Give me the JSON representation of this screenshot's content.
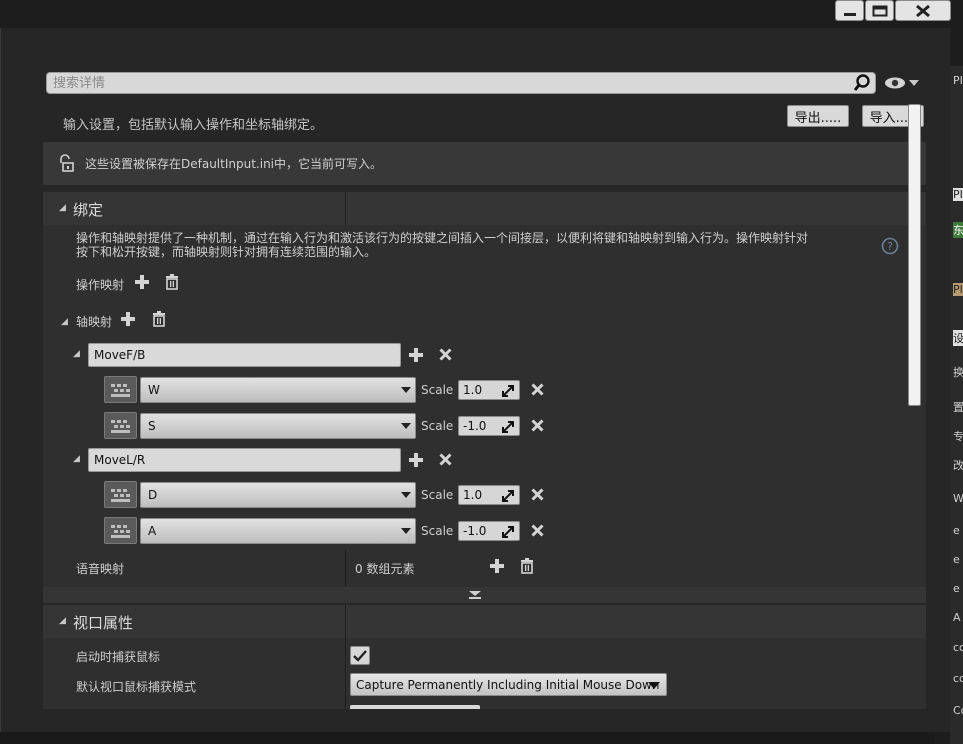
{
  "search": {
    "placeholder": "搜索详情"
  },
  "header": {
    "description": "输入设置，包括默认输入操作和坐标轴绑定。",
    "export_label": "导出.....",
    "import_label": "导入....."
  },
  "notice": {
    "text": "这些设置被保存在DefaultInput.ini中，它当前可写入。"
  },
  "bindings": {
    "title": "绑定",
    "help_line1": "操作和轴映射提供了一种机制，通过在输入行为和激活该行为的按键之间插入一个间接层，以便利将键和轴映射到输入行为。操作映射针对",
    "help_line2": "按下和松开按键，而轴映射则针对拥有连续范围的输入。",
    "action_mappings_label": "操作映射",
    "axis_mappings_label": "轴映射",
    "scale_label": "Scale",
    "axis_groups": [
      {
        "name": "MoveF/B",
        "keys": [
          {
            "key": "W",
            "scale": "1.0"
          },
          {
            "key": "S",
            "scale": "-1.0"
          }
        ]
      },
      {
        "name": "MoveL/R",
        "keys": [
          {
            "key": "D",
            "scale": "1.0"
          },
          {
            "key": "A",
            "scale": "-1.0"
          }
        ]
      }
    ],
    "speech_mappings_label": "语音映射",
    "speech_mappings_value": "0 数组元素"
  },
  "viewport": {
    "title": "视口属性",
    "capture_on_start_label": "启动时捕获鼠标",
    "capture_on_start_checked": true,
    "capture_mode_label": "默认视口鼠标捕获模式",
    "capture_mode_value": "Capture Permanently Including Initial Mouse Down"
  },
  "right_fragments": [
    "PI",
    "东",
    "Pla",
    "设",
    "换",
    "置",
    "专",
    "改",
    "W",
    "e",
    "e",
    "e",
    "A",
    "co",
    "co",
    "Co"
  ],
  "colors": {
    "background": "#262626",
    "panel": "#2f2f2f",
    "field": "#d9d9d9",
    "green_fragment": "#3f7a3a"
  },
  "icons": [
    "minimize-icon",
    "maximize-icon",
    "close-icon",
    "search-icon",
    "eye-icon",
    "lock-icon",
    "help-icon",
    "plus-icon",
    "trash-icon",
    "remove-icon",
    "keyboard-icon",
    "key-select-icon",
    "chevron-down-icon"
  ]
}
